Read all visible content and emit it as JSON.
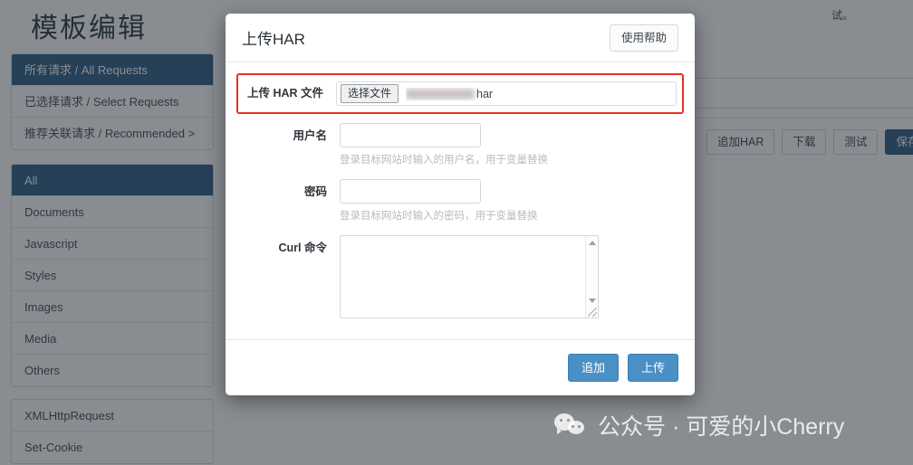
{
  "page": {
    "title": "模板编辑",
    "top_note": "试。"
  },
  "sidebar": {
    "request_groups": [
      {
        "label": "所有请求 / All Requests",
        "active": true
      },
      {
        "label": "已选择请求 / Select Requests",
        "active": false
      },
      {
        "label": "推荐关联请求 / Recommended >",
        "active": false
      }
    ],
    "type_filters": [
      {
        "label": "All",
        "active": true
      },
      {
        "label": "Documents",
        "active": false
      },
      {
        "label": "Javascript",
        "active": false
      },
      {
        "label": "Styles",
        "active": false
      },
      {
        "label": "Images",
        "active": false
      },
      {
        "label": "Media",
        "active": false
      },
      {
        "label": "Others",
        "active": false
      }
    ],
    "extra_filters": [
      {
        "label": "XMLHttpRequest",
        "active": false
      },
      {
        "label": "Set-Cookie",
        "active": false
      }
    ]
  },
  "background_toolbar": {
    "buttons": [
      {
        "label": "追加HAR",
        "primary": false
      },
      {
        "label": "下载",
        "primary": false
      },
      {
        "label": "测试",
        "primary": false
      },
      {
        "label": "保存",
        "primary": true
      }
    ]
  },
  "modal": {
    "title": "上传HAR",
    "help_button": "使用帮助",
    "fields": {
      "file": {
        "label": "上传 HAR 文件",
        "choose_button": "选择文件",
        "file_name_suffix": "har",
        "highlighted": true,
        "highlight_color": "#ed2f24"
      },
      "username": {
        "label": "用户名",
        "value": "",
        "placeholder": "",
        "hint": "登录目标网站时输入的用户名，用于变量替换"
      },
      "password": {
        "label": "密码",
        "value": "",
        "placeholder": "",
        "hint": "登录目标网站时输入的密码，用于变量替换"
      },
      "curl": {
        "label": "Curl 命令",
        "value": "",
        "placeholder": ""
      }
    },
    "footer_buttons": [
      {
        "label": "追加"
      },
      {
        "label": "上传"
      }
    ]
  },
  "watermark": {
    "icon": "wechat-icon",
    "text": "公众号 · 可爱的小Cherry"
  },
  "colors": {
    "sidebar_active": "#245580",
    "primary_button": "#4a90c4",
    "highlight_red": "#ed2f24",
    "overlay": "rgba(40,48,55,0.55)"
  }
}
